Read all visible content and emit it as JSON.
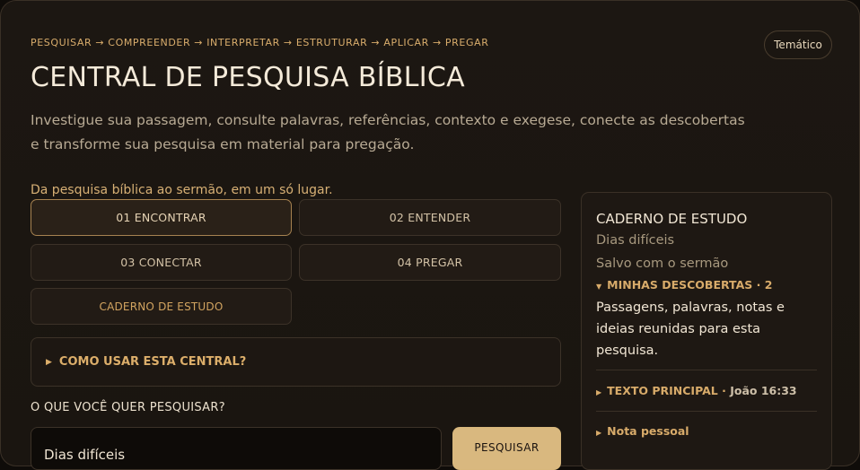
{
  "header": {
    "breadcrumb": "PESQUISAR → COMPREENDER → INTERPRETAR → ESTRUTURAR → APLICAR → PREGAR",
    "mode_label": "Temático",
    "title": "CENTRAL DE PESQUISA BÍBLICA",
    "subtitle": "Investigue sua passagem, consulte palavras, referências, contexto e exegese, conecte as descobertas e transforme sua pesquisa em material para pregação.",
    "tagline": "Da pesquisa bíblica ao sermão, em um só lugar."
  },
  "steps": [
    {
      "label": "01 ENCONTRAR",
      "active": true
    },
    {
      "label": "02 ENTENDER",
      "active": false
    },
    {
      "label": "03 CONECTAR",
      "active": false
    },
    {
      "label": "04 PREGAR",
      "active": false
    },
    {
      "label": "CADERNO DE ESTUDO",
      "active": false
    }
  ],
  "howto": {
    "label": "COMO USAR ESTA CENTRAL?"
  },
  "search": {
    "question": "O QUE VOCÊ QUER PESQUISAR?",
    "value": "Dias difíceis",
    "button_label": "PESQUISAR"
  },
  "notebook": {
    "title": "CADERNO DE ESTUDO",
    "name": "Dias difíceis",
    "status": "Salvo com o sermão",
    "discoveries_label": "MINHAS DESCOBERTAS · 2",
    "discoveries_desc": "Passagens, palavras, notas e ideias reunidas para esta pesquisa.",
    "main_text_label": "TEXTO PRINCIPAL ·",
    "main_text_ref": "João 16:33",
    "note_label": "Nota pessoal"
  },
  "colors": {
    "accent": "#d9b87f",
    "gold_text": "#d8ab6a",
    "background": "#1c1712"
  }
}
